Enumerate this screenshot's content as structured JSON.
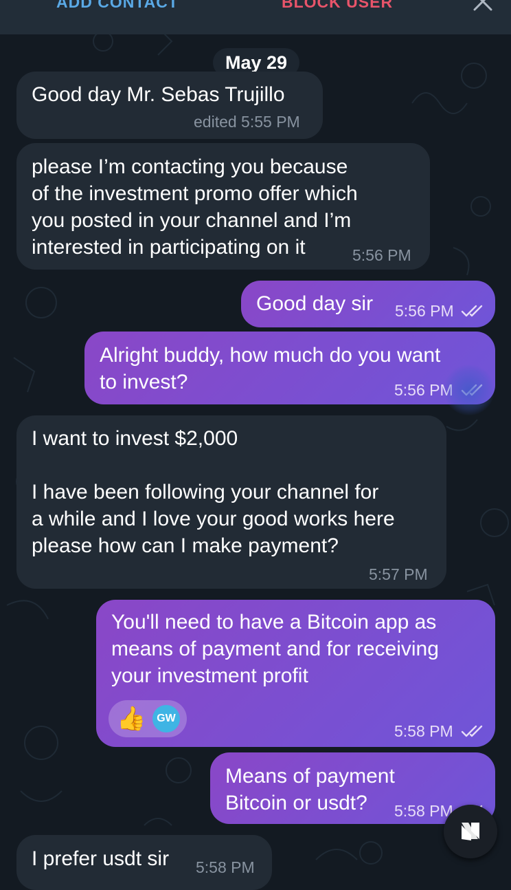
{
  "header": {
    "add_contact": "ADD CONTACT",
    "block_user": "BLOCK USER",
    "close_icon": "close-icon"
  },
  "date_separator": "May 29",
  "messages": [
    {
      "direction": "incoming",
      "lines": [
        "Good day Mr. Sebas Trujillo"
      ],
      "time": "edited 5:55 PM"
    },
    {
      "direction": "incoming",
      "lines": [
        "please I’m contacting you because",
        "of the investment promo offer which",
        "you posted in your channel and I’m",
        "interested in participating on it"
      ],
      "time": "5:56 PM"
    },
    {
      "direction": "outgoing",
      "lines": [
        "Good day sir"
      ],
      "time": "5:56 PM",
      "read": true
    },
    {
      "direction": "outgoing",
      "lines": [
        "Alright buddy, how much do you want",
        "to invest?"
      ],
      "time": "5:56 PM",
      "read": true
    },
    {
      "direction": "incoming",
      "lines": [
        "I want to invest $2,000",
        "",
        "I have been following your channel for",
        "a while and I love your good works here",
        "please how can I make payment?"
      ],
      "time": "5:57 PM"
    },
    {
      "direction": "outgoing",
      "lines": [
        "You'll need to have a Bitcoin app as",
        "means of payment and for receiving",
        "your investment profit"
      ],
      "time": "5:58 PM",
      "read": true,
      "reaction": {
        "emoji": "👍",
        "user_initials": "GW"
      }
    },
    {
      "direction": "outgoing",
      "lines": [
        "Means of payment",
        "Bitcoin or usdt?"
      ],
      "time": "5:58 PM",
      "read": true
    },
    {
      "direction": "incoming",
      "lines": [
        "I prefer usdt sir"
      ],
      "time": "5:58 PM"
    }
  ],
  "floating_button_icon": "app-logo-icon",
  "colors": {
    "background": "#131a22",
    "incoming_bubble": "#222b35",
    "outgoing_bubble_start": "#8a47c7",
    "outgoing_bubble_end": "#6f55d8",
    "add_contact": "#5aa9e6",
    "block_user": "#e8546a"
  }
}
